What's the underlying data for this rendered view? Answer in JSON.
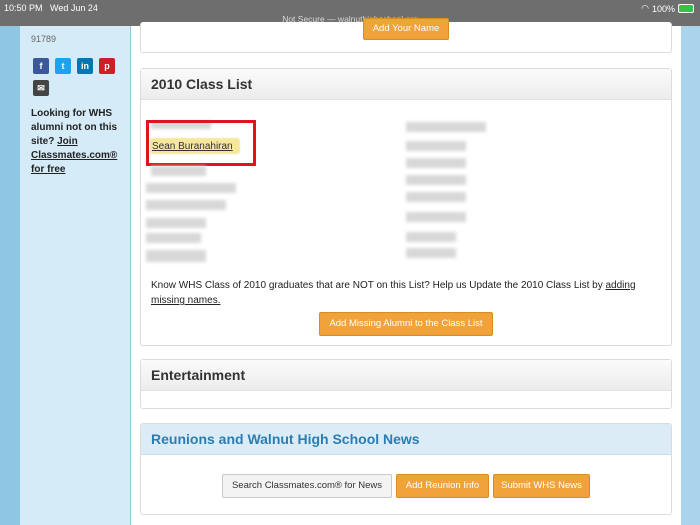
{
  "status_bar": {
    "time": "10:50 PM",
    "date": "Wed Jun 24",
    "url": "Not Secure — walnuthighschool.org",
    "battery": "100%"
  },
  "sidebar": {
    "zip": "91789",
    "social": [
      {
        "icon": "facebook-icon",
        "glyph": "f",
        "color": "#3b5998"
      },
      {
        "icon": "twitter-icon",
        "glyph": "t",
        "color": "#1da1f2"
      },
      {
        "icon": "linkedin-icon",
        "glyph": "in",
        "color": "#0077b5"
      },
      {
        "icon": "pinterest-icon",
        "glyph": "p",
        "color": "#cb2027"
      },
      {
        "icon": "email-icon",
        "glyph": "✉",
        "color": "#444444"
      }
    ],
    "looking_text": "Looking for WHS alumni not on this site?",
    "join_link": "Join Classmates.com®",
    "for_free": "for free"
  },
  "top_panel": {
    "button": "Add Your Name"
  },
  "class_list": {
    "title": "2010 Class List",
    "highlighted_name": "Sean Buranahiran",
    "know_text": "Know WHS Class of 2010 graduates that are NOT on this List? Help us Update the 2010 Class List by",
    "know_link": "adding missing names.",
    "add_button": "Add Missing Alumni to the Class List"
  },
  "entertainment": {
    "title": "Entertainment"
  },
  "news": {
    "title": "Reunions and Walnut High School News",
    "search_button": "Search Classmates.com® for News",
    "reunion_button": "Add Reunion Info",
    "submit_button": "Submit WHS News"
  },
  "colors": {
    "accent": "#f0a33a",
    "highlight": "#e0141e",
    "news_title": "#2a7db3"
  }
}
